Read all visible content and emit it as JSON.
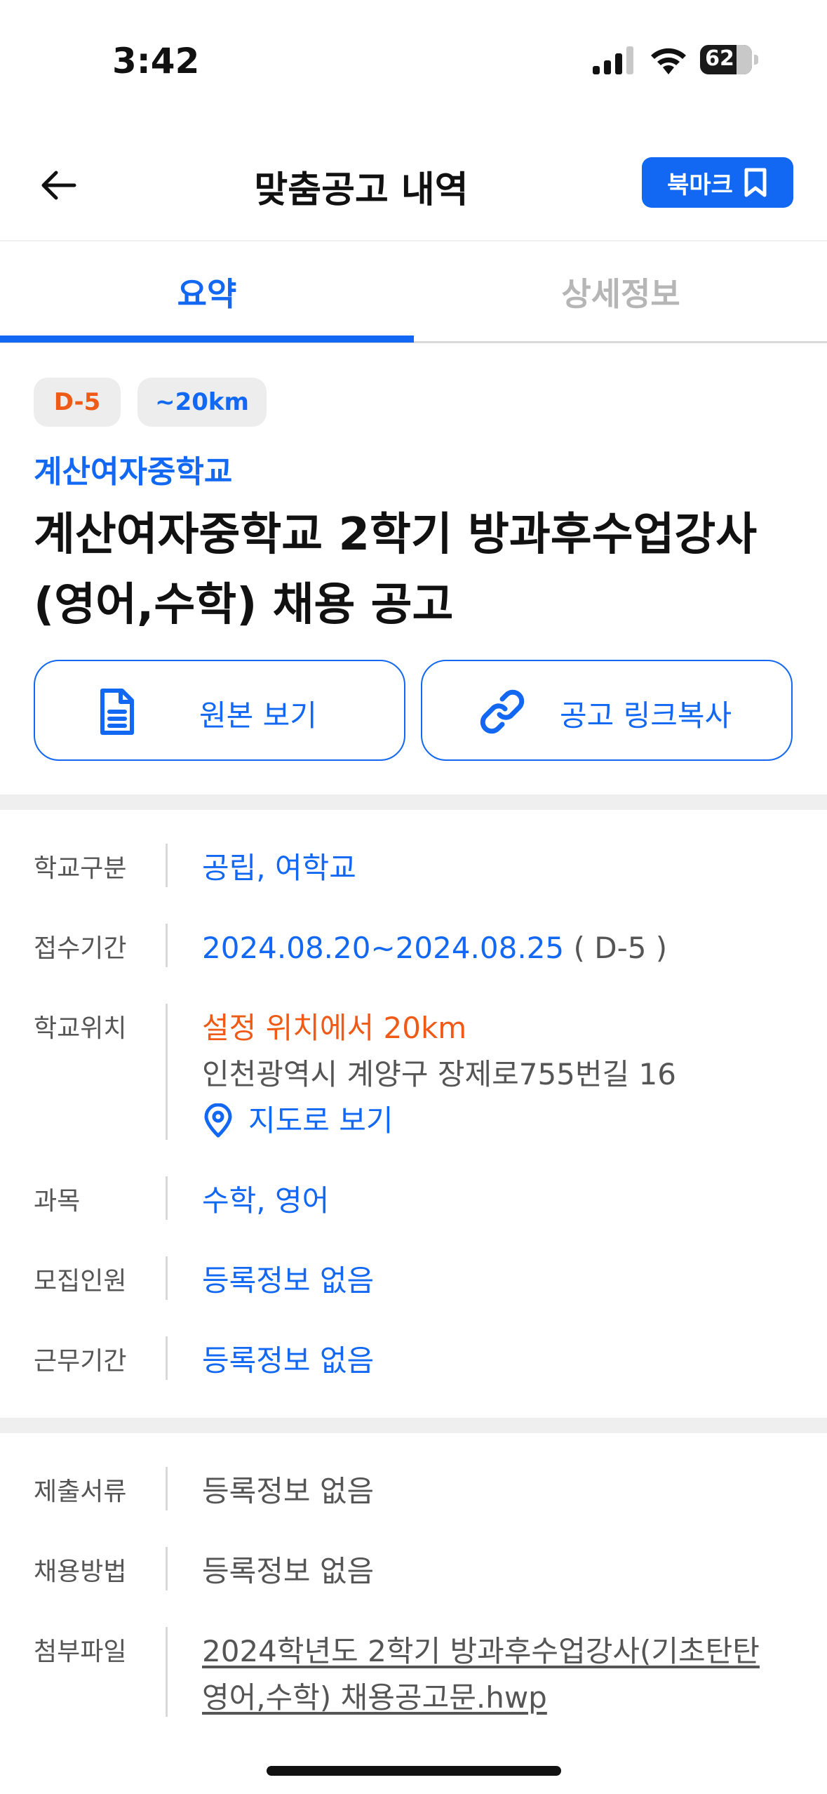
{
  "status_bar": {
    "time": "3:42",
    "battery": "62"
  },
  "header": {
    "title": "맞춤공고 내역",
    "bookmark_label": "북마크"
  },
  "tabs": [
    {
      "label": "요약",
      "active": true
    },
    {
      "label": "상세정보",
      "active": false
    }
  ],
  "badges": {
    "dday": "D-5",
    "distance": "~20km"
  },
  "school_name": "계산여자중학교",
  "post_title": "계산여자중학교 2학기 방과후수업강사(영어,수학) 채용 공고",
  "actions": {
    "view_original": "원본 보기",
    "copy_link": "공고 링크복사"
  },
  "info": {
    "school_type": {
      "label": "학교구분",
      "value": "공립, 여학교"
    },
    "period": {
      "label": "접수기간",
      "value": "2024.08.20~2024.08.25",
      "dday": "( D-5 )"
    },
    "location": {
      "label": "학교위치",
      "distance": "설정 위치에서 20km",
      "address": "인천광역시 계양구 장제로755번길 16",
      "map_link": "지도로 보기"
    },
    "subject": {
      "label": "과목",
      "value": "수학, 영어"
    },
    "recruits": {
      "label": "모집인원",
      "value": "등록정보 없음"
    },
    "work_period": {
      "label": "근무기간",
      "value": "등록정보 없음"
    }
  },
  "extra": {
    "documents": {
      "label": "제출서류",
      "value": "등록정보 없음"
    },
    "method": {
      "label": "채용방법",
      "value": "등록정보 없음"
    },
    "attachment": {
      "label": "첨부파일",
      "line1": "2024학년도 2학기 방과후수업강사(기초탄탄",
      "line2": "영어,수학) 채용공고문.hwp"
    }
  },
  "colors": {
    "accent": "#1268f3",
    "orange": "#ef5b17"
  },
  "icons": {
    "back": "arrow-left-icon",
    "bookmark": "bookmark-icon",
    "document": "document-icon",
    "link": "link-icon",
    "map": "map-pin-icon"
  }
}
